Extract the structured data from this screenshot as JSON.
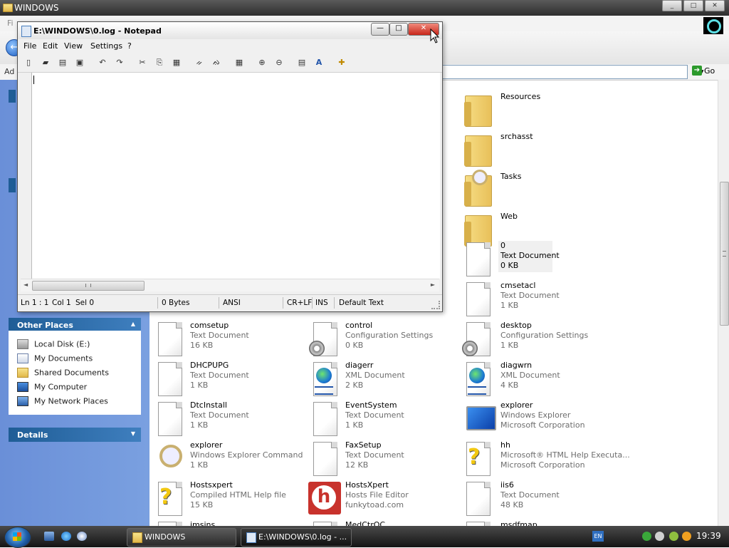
{
  "explorer": {
    "title": "WINDOWS",
    "menu_hint": "Fi",
    "address_label": "Ad",
    "go_label": "Go",
    "window_buttons": [
      "_",
      "□",
      "✕"
    ],
    "back_glyph": "←"
  },
  "task_pane": {
    "other_places_title": "Other Places",
    "other_places_items": [
      "Local Disk (E:)",
      "My Documents",
      "Shared Documents",
      "My Computer",
      "My Network Places"
    ],
    "details_title": "Details",
    "collapse_glyph": "▲",
    "expand_glyph": "▼"
  },
  "files": {
    "right_column": [
      {
        "name": "Resources",
        "type": "folder"
      },
      {
        "name": "srchasst",
        "type": "folder"
      },
      {
        "name": "Tasks",
        "type": "folder"
      },
      {
        "name": "Web",
        "type": "folder"
      },
      {
        "name": "0",
        "kind": "Text Document",
        "size": "0 KB",
        "icon": "text-document-icon"
      },
      {
        "name": "cmsetacl",
        "kind": "Text Document",
        "size": "1 KB",
        "icon": "text-document-icon"
      },
      {
        "name": "desktop",
        "kind": "Configuration Settings",
        "size": "1 KB",
        "icon": "config-file-icon"
      },
      {
        "name": "diagwrn",
        "kind": "XML Document",
        "size": "4 KB",
        "icon": "xml-document-icon"
      },
      {
        "name": "explorer",
        "kind": "Windows Explorer",
        "size": "Microsoft Corporation",
        "icon": "explorer-app-icon"
      },
      {
        "name": "hh",
        "kind": "Microsoft® HTML Help Executa...",
        "size": "Microsoft Corporation",
        "icon": "help-executable-icon"
      },
      {
        "name": "iis6",
        "kind": "Text Document",
        "size": "48 KB",
        "icon": "text-document-icon"
      },
      {
        "name": "msdfmap",
        "kind": "",
        "size": "",
        "icon": "text-document-icon"
      }
    ],
    "left_column": [
      {
        "name": "comsetup",
        "kind": "Text Document",
        "size": "16 KB",
        "icon": "text-document-icon"
      },
      {
        "name": "DHCPUPG",
        "kind": "Text Document",
        "size": "1 KB",
        "icon": "text-document-icon"
      },
      {
        "name": "DtcInstall",
        "kind": "Text Document",
        "size": "1 KB",
        "icon": "text-document-icon"
      },
      {
        "name": "explorer",
        "kind": "Windows Explorer Command",
        "size": "1 KB",
        "icon": "explorer-command-icon"
      },
      {
        "name": "Hostsxpert",
        "kind": "Compiled HTML Help file",
        "size": "15 KB",
        "icon": "help-file-icon"
      },
      {
        "name": "imsins",
        "kind": "",
        "size": "",
        "icon": "text-document-icon"
      }
    ],
    "middle_column": [
      {
        "name": "control",
        "kind": "Configuration Settings",
        "size": "0 KB",
        "icon": "config-file-icon"
      },
      {
        "name": "diagerr",
        "kind": "XML Document",
        "size": "2 KB",
        "icon": "xml-document-icon"
      },
      {
        "name": "EventSystem",
        "kind": "Text Document",
        "size": "1 KB",
        "icon": "text-document-icon"
      },
      {
        "name": "FaxSetup",
        "kind": "Text Document",
        "size": "12 KB",
        "icon": "text-document-icon"
      },
      {
        "name": "HostsXpert",
        "kind": "Hosts File Editor",
        "size": "funkytoad.com",
        "icon": "hostsxpert-app-icon"
      },
      {
        "name": "MedCtrOC",
        "kind": "",
        "size": "",
        "icon": "text-document-icon"
      }
    ]
  },
  "notepad": {
    "title": "E:\\WINDOWS\\0.log - Notepad",
    "menu": [
      "File",
      "Edit",
      "View",
      "Settings",
      "?"
    ],
    "window_buttons": [
      "—",
      "□",
      "✕"
    ],
    "toolbar_glyphs": [
      "▯",
      "▰",
      "▤",
      "▣",
      "↶",
      "↷",
      "✂",
      "⎘",
      "▦",
      "ᨀ",
      "ᨁ",
      "▦",
      "⊕",
      "⊖",
      "▤",
      "A",
      "✚"
    ],
    "status": {
      "position": "Ln 1 : 1",
      "col": "Col 1",
      "sel": "Sel 0",
      "bytes": "0 Bytes",
      "encoding": "ANSI",
      "eol": "CR+LF",
      "mode": "INS",
      "scheme": "Default Text"
    },
    "scroll_left": "◄",
    "scroll_right": "►"
  },
  "taskbar": {
    "buttons": [
      {
        "label": "WINDOWS",
        "icon": "folder-icon"
      },
      {
        "label": "E:\\WINDOWS\\0.log - ...",
        "icon": "notepad-icon"
      }
    ],
    "language": "EN",
    "clock": "19:39"
  },
  "colors": {
    "pane_blue": "#7aa0e0",
    "pane_header": "#1f5d96",
    "close_red": "#c8261a",
    "secondary_text": "#6d6d6d"
  }
}
